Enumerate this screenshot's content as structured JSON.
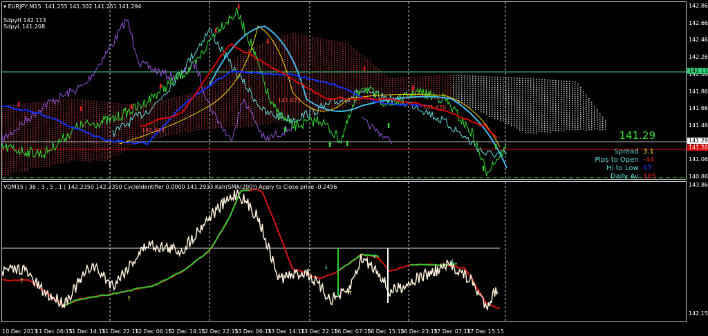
{
  "header": {
    "symbol": "EURJPY,M15",
    "ohlc": "141.255 141.302 141.251 141.294",
    "sdpy_high": "SdpyH 142.113",
    "sdpy_low": "SdpyL 141.208"
  },
  "price_scale": [
    "142.865",
    "142.665",
    "142.465",
    "142.265",
    "142.065",
    "141.865",
    "141.665",
    "141.465",
    "141.265",
    "141.065",
    "140.865"
  ],
  "price_tags": {
    "green": "142.113",
    "bid": "141.294",
    "red": "141.208"
  },
  "info_panel": {
    "price": "141.29",
    "spread_label": "Spread",
    "spread": "3.1",
    "pips_open_label": "Pips to Open",
    "pips_open": "-44",
    "hi_low_label": "Hi to Low",
    "hi_low": "97",
    "daily_av_label": "Daily Av",
    "daily_av": "185"
  },
  "indicator": {
    "header": "VQM15 | 36 , 3 , 5 , 1 | 142.2350 142.2350 CycleIdentifier 0.0000 141.2933 Kalr(SMA(200)) Apply to Close price -0.2496",
    "scale_top": "143.8600",
    "scale_bottom": "142.1575"
  },
  "chart_labels": [
    "141.314",
    "141.673",
    "141.670"
  ],
  "time_axis": [
    "10 Dec 2013",
    "11 Dec 06:15",
    "11 Dec 14:15",
    "11 Dec 22:15",
    "12 Dec 06:15",
    "12 Dec 14:15",
    "12 Dec 22:15",
    "13 Dec 06:15",
    "13 Dec 14:15",
    "13 Dec 22:15",
    "16 Dec 07:15",
    "16 Dec 15:15",
    "16 Dec 23:15",
    "17 Dec 07:15",
    "17 Dec 15:15"
  ],
  "colors": {
    "green": "#33dd33",
    "purple": "#9955dd",
    "cyan": "#66dddd",
    "cloud": "#aa3333",
    "yellow": "#ffdd00",
    "blue": "#1133ff",
    "red": "#dd0000"
  }
}
